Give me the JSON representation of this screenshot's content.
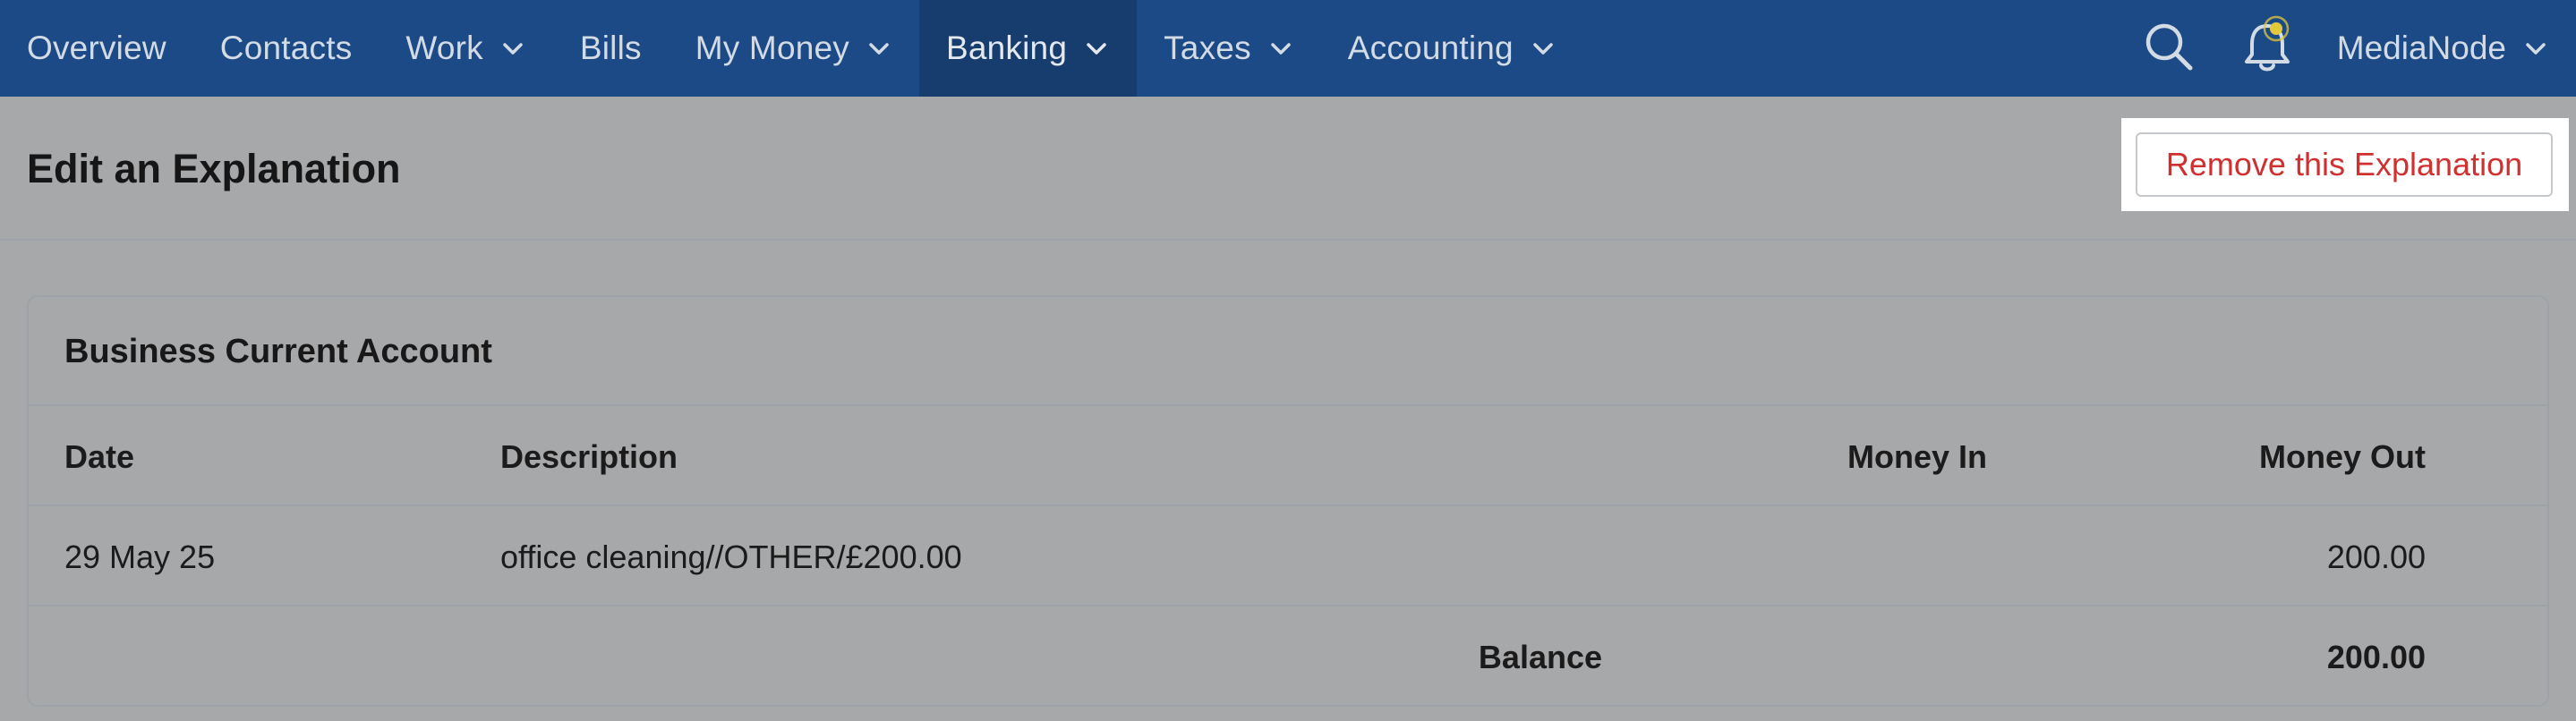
{
  "nav": {
    "items": [
      {
        "label": "Overview",
        "has_dropdown": false,
        "active": false
      },
      {
        "label": "Contacts",
        "has_dropdown": false,
        "active": false
      },
      {
        "label": "Work",
        "has_dropdown": true,
        "active": false
      },
      {
        "label": "Bills",
        "has_dropdown": false,
        "active": false
      },
      {
        "label": "My Money",
        "has_dropdown": true,
        "active": false
      },
      {
        "label": "Banking",
        "has_dropdown": true,
        "active": true
      },
      {
        "label": "Taxes",
        "has_dropdown": true,
        "active": false
      },
      {
        "label": "Accounting",
        "has_dropdown": true,
        "active": false
      }
    ],
    "search_icon": "search-icon",
    "notification_icon": "bell-icon",
    "account_name": "MediaNode"
  },
  "page": {
    "title": "Edit an Explanation",
    "remove_button_label": "Remove this Explanation"
  },
  "account": {
    "name": "Business Current Account",
    "columns": {
      "date": "Date",
      "description": "Description",
      "money_in": "Money In",
      "money_out": "Money Out"
    },
    "rows": [
      {
        "date": "29 May 25",
        "description": "office cleaning//OTHER/£200.00",
        "money_in": "",
        "money_out": "200.00"
      }
    ],
    "balance_label": "Balance",
    "balance_value": "200.00"
  },
  "colors": {
    "nav_background": "#1c4a86",
    "nav_active_background": "#173d6f",
    "nav_text": "#d3dbe5",
    "overlay_background": "#a7a8aa",
    "danger_text": "#d03030",
    "notification_dot": "#e2c93c"
  }
}
